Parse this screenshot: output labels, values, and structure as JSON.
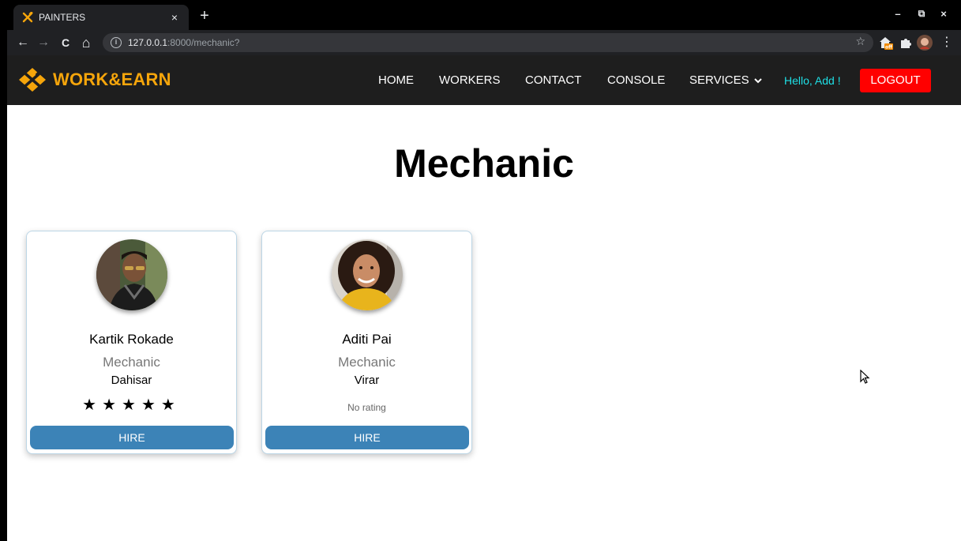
{
  "browser": {
    "tab_title": "PAINTERS",
    "tab_close": "×",
    "new_tab": "+",
    "url_host": "127.0.0.1",
    "url_rest": ":8000/mechanic?",
    "back": "←",
    "forward": "→",
    "reload": "C",
    "home": "⌂",
    "star": "☆",
    "minimize": "–",
    "restore": "⧉",
    "close": "×",
    "menu": "⋮"
  },
  "site": {
    "brand": "WORK&EARN",
    "nav": [
      "HOME",
      "WORKERS",
      "CONTACT",
      "CONSOLE",
      "SERVICES"
    ],
    "greeting": "Hello, Add !",
    "logout": "LOGOUT",
    "brand_color": "#f5a50b",
    "logout_color": "#ff0000",
    "greeting_color": "#1ee0e6"
  },
  "page": {
    "title": "Mechanic"
  },
  "workers": [
    {
      "name": "Kartik Rokade",
      "role": "Mechanic",
      "location": "Dahisar",
      "stars": "★★★★★",
      "rating": 5,
      "hire": "HIRE"
    },
    {
      "name": "Aditi Pai",
      "role": "Mechanic",
      "location": "Virar",
      "no_rating": "No rating",
      "hire": "HIRE"
    }
  ],
  "colors": {
    "hire_button": "#3c83b7"
  }
}
